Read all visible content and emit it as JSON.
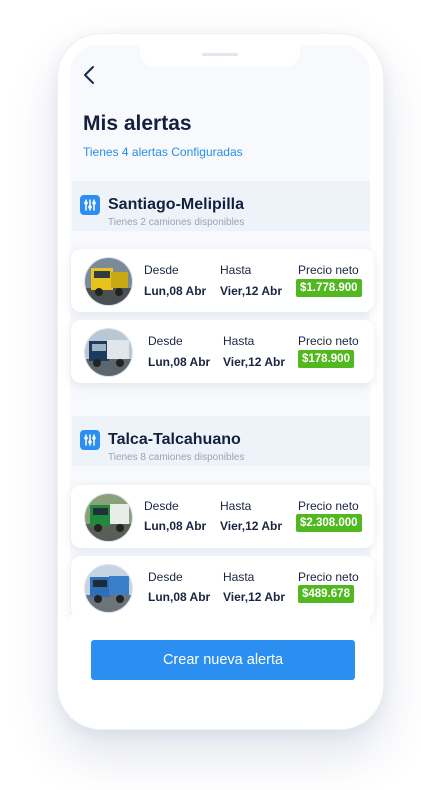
{
  "header": {
    "title": "Mis alertas",
    "subtitle": "Tienes 4 alertas Configuradas"
  },
  "colors": {
    "accent": "#2a8ff0",
    "price_badge": "#52b81f",
    "title": "#14213d"
  },
  "groups": [
    {
      "title": "Santiago-Melipilla",
      "subtitle": "Tienes 2 camiones disponibles",
      "items": [
        {
          "truck": "yellow-truck-photo",
          "desde_label": "Desde",
          "desde": "Lun,08 Abr",
          "hasta_label": "Hasta",
          "hasta": "Vier,12 Abr",
          "precio_label": "Precio neto",
          "precio": "$1.778.900"
        },
        {
          "truck": "dark-blue-truck-photo",
          "desde_label": "Desde",
          "desde": "Lun,08 Abr",
          "hasta_label": "Hasta",
          "hasta": "Vier,12 Abr",
          "precio_label": "Precio neto",
          "precio": "$178.900"
        }
      ]
    },
    {
      "title": "Talca-Talcahuano",
      "subtitle": "Tienes 8 camiones disponibles",
      "items": [
        {
          "truck": "green-truck-photo",
          "desde_label": "Desde",
          "desde": "Lun,08 Abr",
          "hasta_label": "Hasta",
          "hasta": "Vier,12 Abr",
          "precio_label": "Precio neto",
          "precio": "$2.308.000"
        },
        {
          "truck": "blue-truck-photo",
          "desde_label": "Desde",
          "desde": "Lun,08 Abr",
          "hasta_label": "Hasta",
          "hasta": "Vier,12 Abr",
          "precio_label": "Precio neto",
          "precio": "$489.678"
        }
      ]
    }
  ],
  "cta": {
    "label": "Crear nueva alerta"
  }
}
